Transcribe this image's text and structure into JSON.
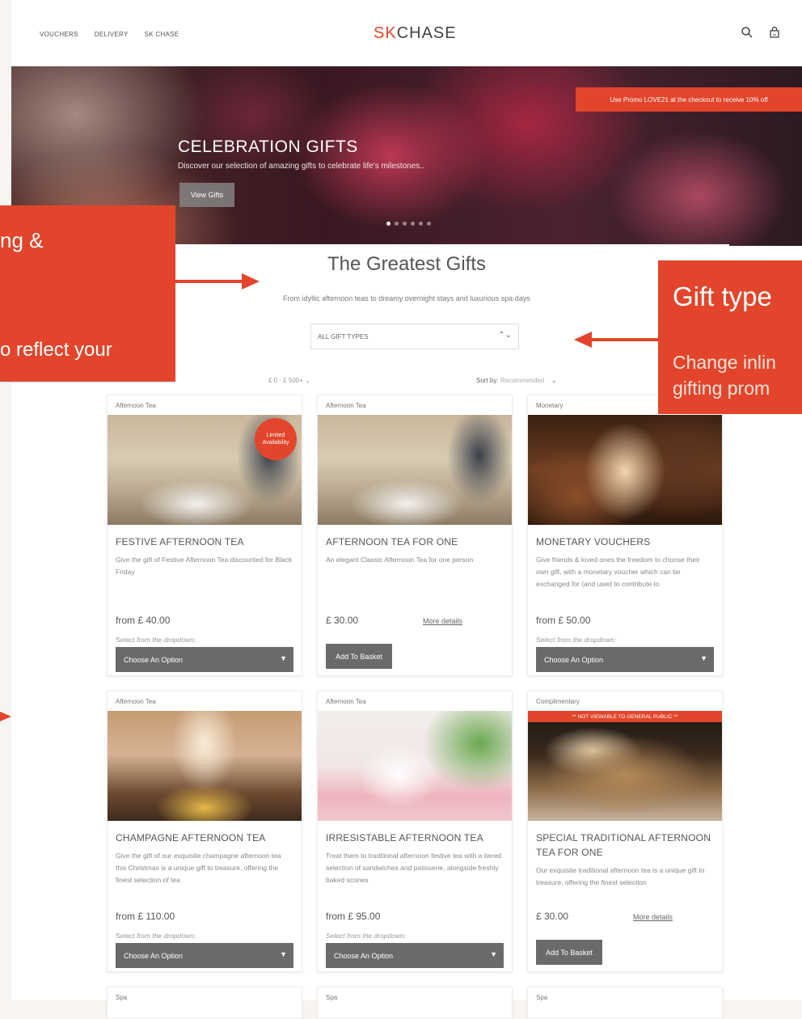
{
  "header": {
    "nav": [
      "VOUCHERS",
      "DELIVERY",
      "SK CHASE"
    ],
    "logo_sk": "SK",
    "logo_chase": "CHASE"
  },
  "hero": {
    "promo": "Use Promo LOVE21 at the checkout to receive 10% off",
    "title": "CELEBRATION GIFTS",
    "subtitle": "Discover our selection of amazing gifts to celebrate life's milestones..",
    "button": "View Gifts"
  },
  "section": {
    "title": "The Greatest Gifts",
    "subtitle": "From idyllic afternoon teas to dreamy overnight stays and luxurious spa days",
    "filter_select": "ALL GIFT TYPES",
    "price_filter": "£ 0 - £ 500+",
    "sort_label": "Sort by:",
    "sort_value": "Recommended"
  },
  "cards": [
    {
      "category": "Afternoon Tea",
      "badge": "Limited Availability",
      "name": "FESTIVE AFTERNOON TEA",
      "desc": "Give the gift of Festive Afternoon Tea discounted for Black Friday",
      "price": "from £ 40.00",
      "hint": "Select from the dropdown:",
      "action": "Choose An Option"
    },
    {
      "category": "Afternoon Tea",
      "name": "AFTERNOON TEA FOR ONE",
      "desc": "An elegant Classic Afternoon Tea for one person",
      "price": "£ 30.00",
      "more": "More details",
      "action": "Add To Basket"
    },
    {
      "category": "Monetary",
      "name": "MONETARY VOUCHERS",
      "desc": "Give friends & loved ones the freedom to choose their own gift, with a monetary voucher which can be exchanged for (and used to contribute to",
      "price": "from £ 50.00",
      "hint": "Select from the dropdown:",
      "action": "Choose An Option"
    },
    {
      "category": "Afternoon Tea",
      "name": "CHAMPAGNE AFTERNOON TEA",
      "desc": "Give the gift of our exquisite champagne afternoon tea this Christmas is a unique gift to treasure, offering the finest selection of tea",
      "price": "from £ 110.00",
      "hint": "Select from the dropdown:",
      "action": "Choose An Option"
    },
    {
      "category": "Afternoon Tea",
      "name": "IRRESISTABLE AFTERNOON TEA",
      "desc": "Treat them to traditional afternoon festive tea with a tiered selection of sandwiches and patisserie, alongside freshly baked scones",
      "price": "from £ 95.00",
      "hint": "Select from the dropdown:",
      "action": "Choose An Option"
    },
    {
      "category": "Complimentary",
      "notice": "** NOT VIEWABLE TO GENERAL PUBLIC **",
      "name": "SPECIAL TRADITIONAL AFTERNOON TEA FOR ONE",
      "desc": "Our exquisite traditional afternoon tea is a unique gift to treasure, offering the finest selection",
      "price": "£ 30.00",
      "more": "More details",
      "action": "Add To Basket"
    },
    {
      "category": "Spa"
    },
    {
      "category": "Spa"
    },
    {
      "category": "Spa"
    }
  ],
  "annotations": {
    "left_line1": "ng &",
    "left_line2": "o reflect your",
    "right_title": "Gift type",
    "right_line1": "Change inlin",
    "right_line2": "gifting prom"
  },
  "colors": {
    "accent": "#e2452b",
    "button": "#6a6a6a"
  }
}
